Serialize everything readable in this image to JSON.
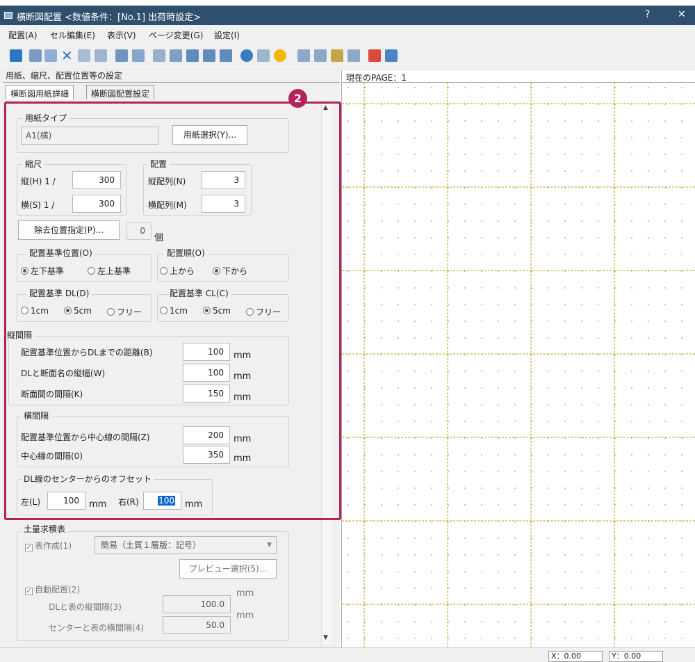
{
  "window": {
    "title": "横断図配置 <数値条件：[No.1] 出荷時設定>",
    "help": "?",
    "close": "✕"
  },
  "menu": [
    "配置(A)",
    "セル編集(E)",
    "表示(V)",
    "ページ変更(G)",
    "設定(I)"
  ],
  "panel_title": "用紙、縮尺、配置位置等の設定",
  "tabs": [
    "横断図用紙詳細",
    "横断図配置設定"
  ],
  "badge": "2",
  "paper": {
    "group": "用紙タイプ",
    "value": "A1(横)",
    "button": "用紙選択(Y)..."
  },
  "scale": {
    "group": "縮尺",
    "v_label": "縦(H) 1 /",
    "v_value": "300",
    "h_label": "横(S) 1 /",
    "h_value": "300"
  },
  "layout": {
    "group": "配置",
    "v_label": "縦配列(N)",
    "v_value": "3",
    "h_label": "横配列(M)",
    "h_value": "3"
  },
  "removal": {
    "button": "除去位置指定(P)...",
    "count": "0",
    "unit": "個"
  },
  "ref_pos": {
    "group": "配置基準位置(O)",
    "opt1": "左下基準",
    "opt2": "左上基準"
  },
  "order": {
    "group": "配置順(O)",
    "opt1": "上から",
    "opt2": "下から"
  },
  "dl": {
    "group": "配置基準 DL(D)",
    "opt1": "1cm",
    "opt2": "5cm",
    "opt3": "フリー"
  },
  "cl": {
    "group": "配置基準 CL(C)",
    "opt1": "1cm",
    "opt2": "5cm",
    "opt3": "フリー"
  },
  "vspacing": {
    "group": "縦間隔",
    "r1_label": "配置基準位置からDLまでの距離(B)",
    "r1_value": "100",
    "r2_label": "DLと断面名の縦幅(W)",
    "r2_value": "100",
    "r3_label": "断面間の間隔(K)",
    "r3_value": "150",
    "unit": "mm"
  },
  "hspacing": {
    "group": "横間隔",
    "r1_label": "配置基準位置から中心線の間隔(Z)",
    "r1_value": "200",
    "r2_label": "中心線の間隔(0)",
    "r2_value": "350",
    "unit": "mm"
  },
  "offset": {
    "group": "DL線のセンターからのオフセット",
    "left_label": "左(L)",
    "left_value": "100",
    "right_label": "右(R)",
    "right_value": "100",
    "unit": "mm"
  },
  "earth": {
    "group": "土量求積表",
    "create_label": "表作成(1)",
    "combo": "簡易（土質１層版：記号）",
    "preview_btn": "プレビュー選択(5)...",
    "auto_label": "自動配置(2)",
    "dl_gap_label": "DLと表の縦間隔(3)",
    "dl_gap_value": "100.0",
    "center_gap_label": "センターと表の横間隔(4)",
    "center_gap_value": "50.0",
    "unit": "mm"
  },
  "canvas": {
    "page_label": "現在のPAGE：1"
  },
  "status": {
    "x": "X：0.00",
    "y": "Y：0.00"
  }
}
